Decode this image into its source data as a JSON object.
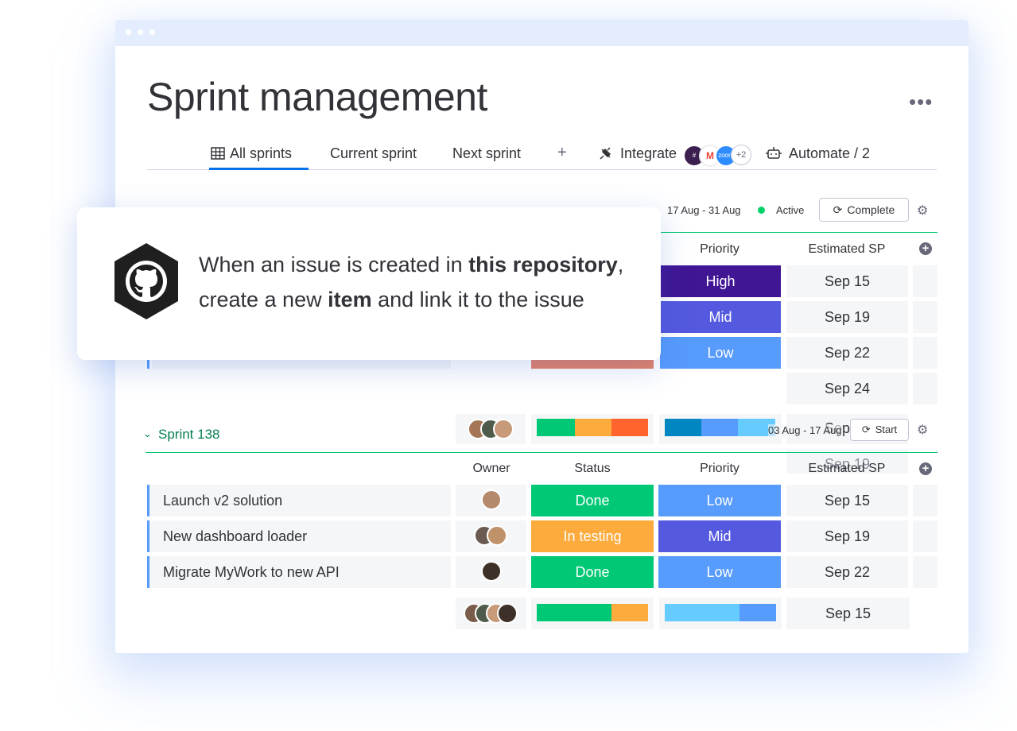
{
  "window": {
    "title": "Sprint management",
    "more_label": "•••"
  },
  "tabs": [
    {
      "label": "All sprints",
      "icon": "table-icon",
      "active": true
    },
    {
      "label": "Current sprint"
    },
    {
      "label": "Next sprint"
    }
  ],
  "toolbar": {
    "add_label": "+",
    "integrate_label": "Integrate",
    "integrate_extra_count": "+2",
    "automate_label": "Automate / 2"
  },
  "current_sprint": {
    "dates": "17 Aug - 31 Aug",
    "state": "Active",
    "complete_label": "Complete",
    "columns": {
      "priority": "Priority",
      "estimated": "Estimated SP"
    },
    "rows": [
      {
        "priority": "High",
        "priority_color": "#401694",
        "estimated": "Sep 15"
      },
      {
        "priority": "Mid",
        "priority_color": "#5559df",
        "estimated": "Sep 19"
      },
      {
        "priority": "Low",
        "priority_color": "#579bfc",
        "estimated": "Sep 22"
      },
      {
        "estimated": "Sep 24"
      }
    ]
  },
  "callout": {
    "line1_pre": "When an issue is created in ",
    "line1_bold": "this repository",
    "line1_post": ",",
    "line2_pre": "create a new ",
    "line2_bold": "item",
    "line2_post": " and link it to the issue"
  },
  "sprint_138": {
    "name": "Sprint 138",
    "dates": "03 Aug - 17 Aug",
    "start_label": "Start",
    "overlap_estimates": [
      "Sep 15",
      "Sep 19"
    ],
    "columns": {
      "owner": "Owner",
      "status": "Status",
      "priority": "Priority",
      "estimated": "Estimated SP"
    },
    "items": [
      {
        "name": "Launch v2 solution",
        "status": "Done",
        "status_color": "#00c875",
        "priority": "Low",
        "priority_color": "#579bfc",
        "estimated": "Sep 15"
      },
      {
        "name": "New dashboard loader",
        "status": "In testing",
        "status_color": "#fdab3d",
        "priority": "Mid",
        "priority_color": "#5559df",
        "estimated": "Sep 19"
      },
      {
        "name": "Migrate MyWork to new API",
        "status": "Done",
        "status_color": "#00c875",
        "priority": "Low",
        "priority_color": "#579bfc",
        "estimated": "Sep 22"
      }
    ],
    "summary_estimated": "Sep 15"
  },
  "colors": {
    "accent": "#0073ea",
    "group_green": "#037f4c",
    "done": "#00c875",
    "working": "#fdab3d",
    "stuck": "#ff642e",
    "high": "#401694",
    "mid": "#5559df",
    "low": "#579bfc",
    "light_low": "#66ccff",
    "dark_low": "#0086c0",
    "active_dot": "#00d26a"
  }
}
